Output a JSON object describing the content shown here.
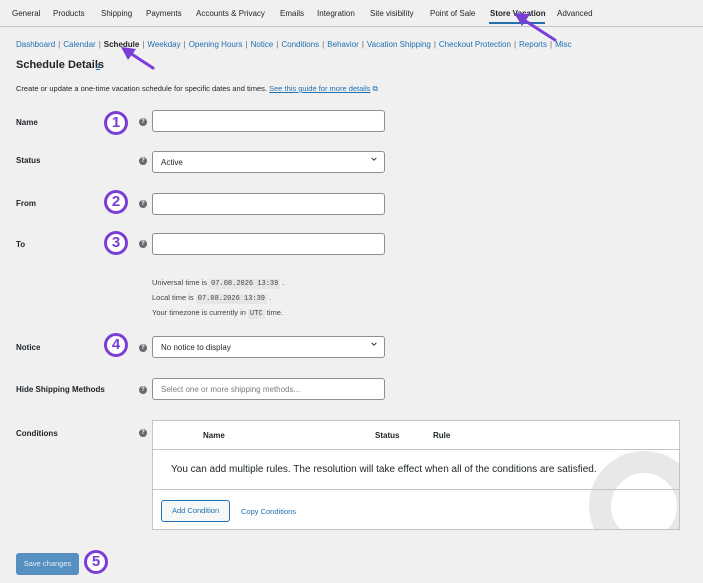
{
  "tabs": [
    "General",
    "Products",
    "Shipping",
    "Payments",
    "Accounts & Privacy",
    "Emails",
    "Integration",
    "Site visibility",
    "Point of Sale",
    "Store Vacation",
    "Advanced"
  ],
  "subnav": {
    "items": [
      "Dashboard",
      "Calendar",
      "Schedule",
      "Weekday",
      "Opening Hours",
      "Notice",
      "Conditions",
      "Behavior",
      "Vacation Shipping",
      "Checkout Protection",
      "Reports",
      "Misc"
    ],
    "active": "Schedule"
  },
  "section": {
    "title": "Schedule Details",
    "title_link": "≥",
    "description": "Create or update a one-time vacation schedule for specific dates and times.",
    "guide_link": "See this guide for more details"
  },
  "fields": {
    "name_label": "Name",
    "status_label": "Status",
    "status_value": "Active",
    "from_label": "From",
    "to_label": "To",
    "notice_label": "Notice",
    "notice_value": "No notice to display",
    "hide_shipping_label": "Hide Shipping Methods",
    "hide_shipping_placeholder": "Select one or more shipping methods...",
    "conditions_label": "Conditions"
  },
  "time_info": {
    "universal_prefix": "Universal time is",
    "universal_value": "07.08.2026 13:39",
    "local_prefix": "Local time is",
    "local_value": "07.08.2026 13:39",
    "tz_prefix": "Your timezone is currently in",
    "tz_value": "UTC",
    "tz_suffix": "time."
  },
  "conditions_table": {
    "headers": [
      "Name",
      "Status",
      "Rule"
    ],
    "empty_message": "You can add multiple rules. The resolution will take effect when all of the conditions are satisfied.",
    "add_button": "Add Condition",
    "copy_button": "Copy Conditions"
  },
  "save_button": "Save changes",
  "badges": [
    "1",
    "2",
    "3",
    "4",
    "5"
  ],
  "colors": {
    "accent": "#2271b1",
    "annotation": "#7a3ed6"
  }
}
